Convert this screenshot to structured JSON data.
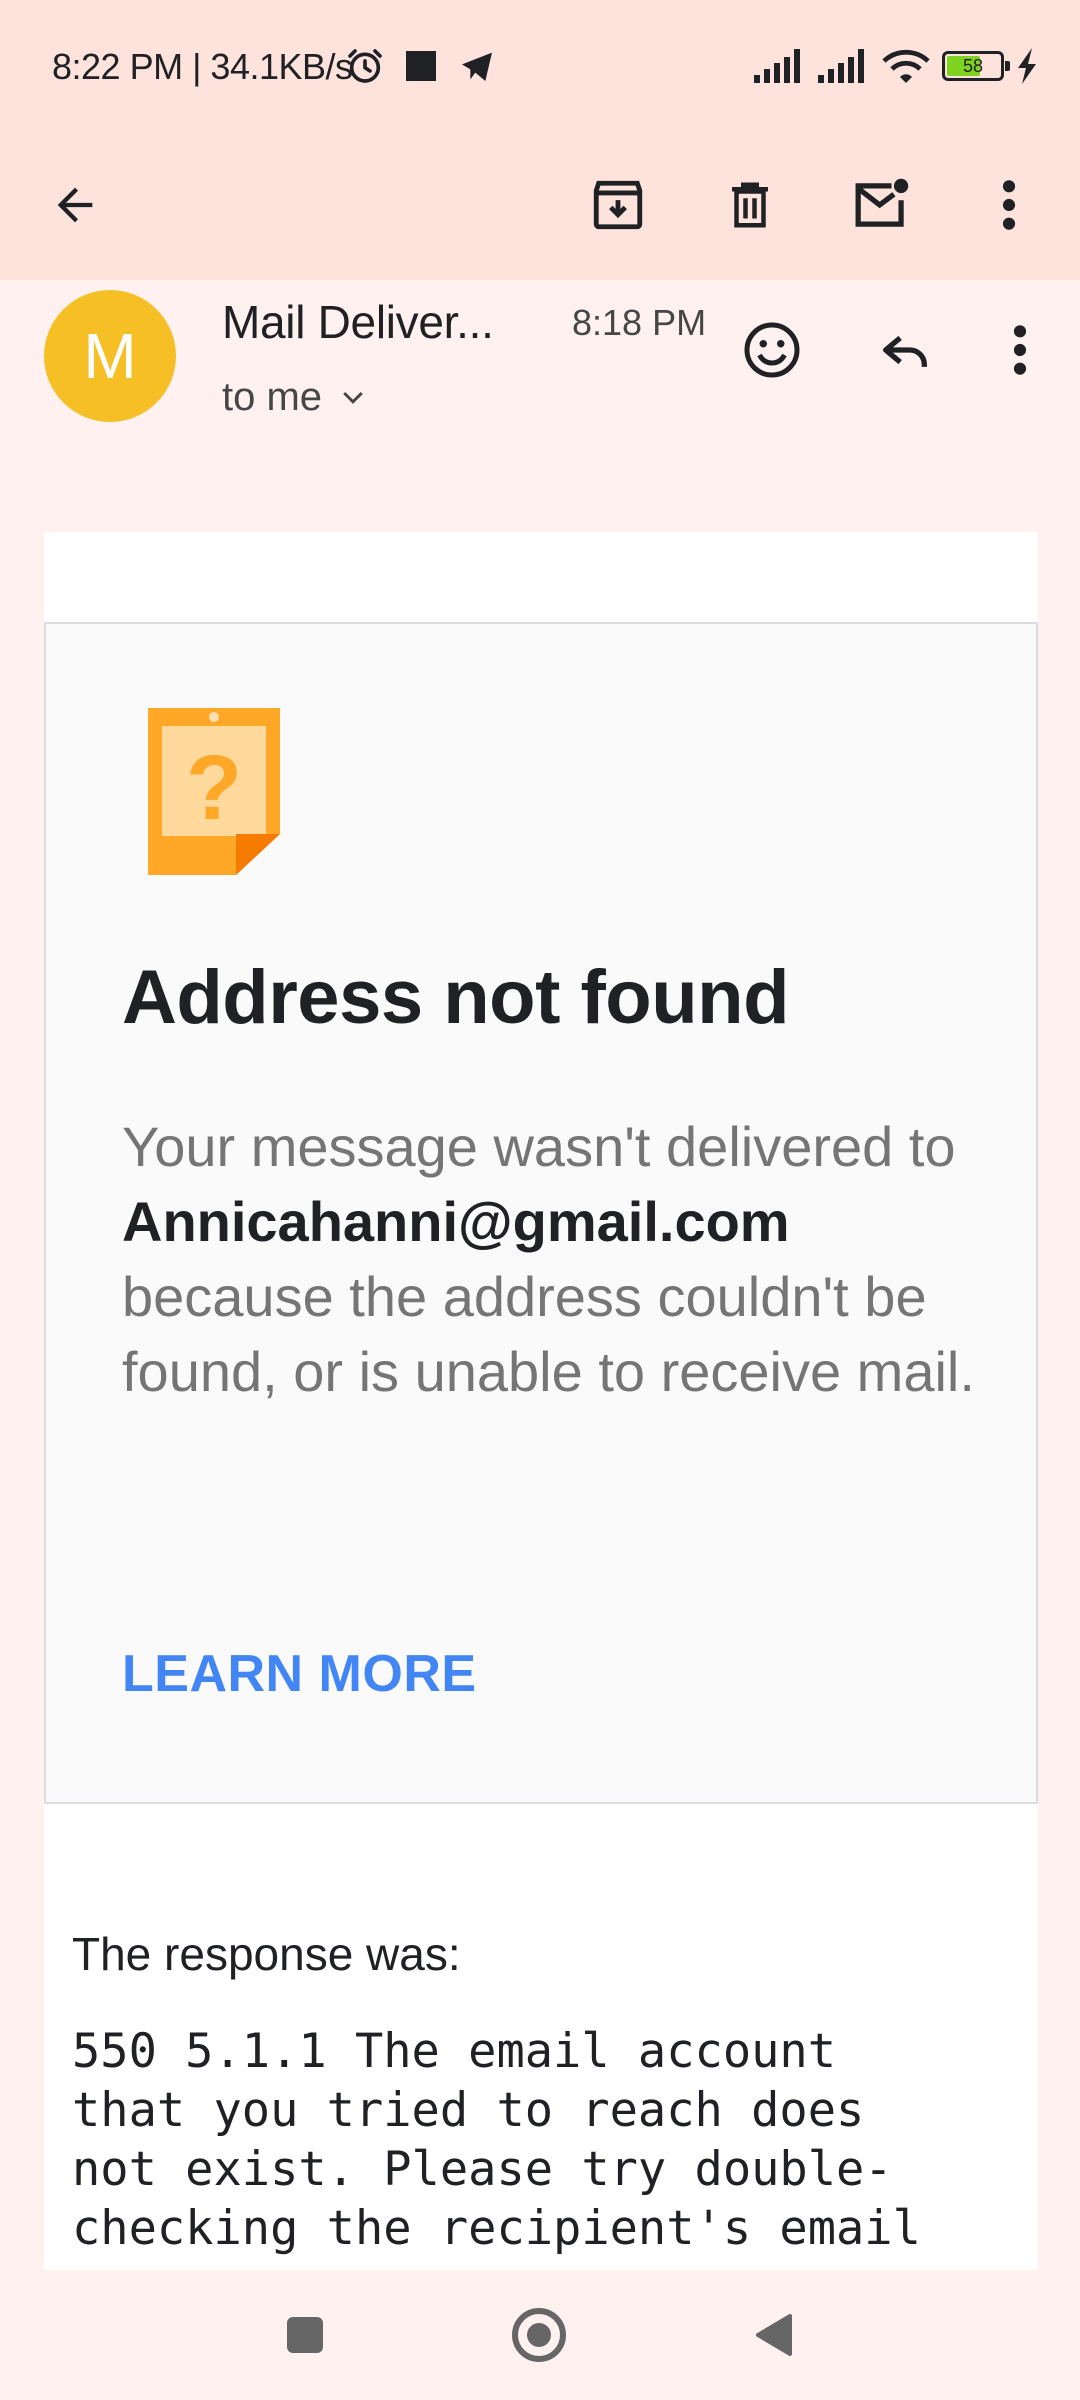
{
  "status_bar": {
    "text": "8:22 PM | 34.1KB/s",
    "battery_level": "58"
  },
  "toolbar": {
    "icons": [
      "back-arrow-icon",
      "archive-icon",
      "delete-icon",
      "mark-unread-icon",
      "more-vert-icon"
    ]
  },
  "message": {
    "avatar_letter": "M",
    "sender": "Mail Deliver...",
    "time": "8:18 PM",
    "recipient": "to me"
  },
  "bounce_card": {
    "title": "Address not found",
    "text_before": "Your message wasn't delivered to",
    "address": "Annicahanni@gmail.com",
    "text_after": "because the address couldn't be found, or is unable to receive mail.",
    "link": "LEARN MORE"
  },
  "response": {
    "label": "The response was:",
    "text": "550 5.1.1 The email account\nthat you tried to reach does\nnot exist. Please try double-\nchecking the recipient's email"
  },
  "colors": {
    "header_bg": "#fde3dc",
    "page_bg": "#fff1ef",
    "avatar": "#f6bf26",
    "link": "#4285f4",
    "icon_orange": "#ffa726"
  }
}
